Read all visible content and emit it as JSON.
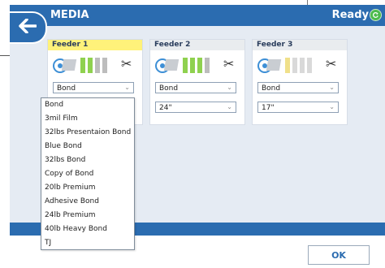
{
  "header": {
    "title": "MEDIA",
    "status": "Ready",
    "accent_color": "#2b6cb0"
  },
  "feeders": [
    {
      "name": "Feeder 1",
      "active": true,
      "media_type": "Bond",
      "width": "",
      "bar_colors": [
        "#8fd14f",
        "#8fd14f",
        "#bdbdbd",
        "#bdbdbd"
      ]
    },
    {
      "name": "Feeder 2",
      "active": false,
      "media_type": "Bond",
      "width": "24\"",
      "bar_colors": [
        "#8fd14f",
        "#8fd14f",
        "#8fd14f",
        "#bdbdbd"
      ]
    },
    {
      "name": "Feeder 3",
      "active": false,
      "media_type": "Bond",
      "width": "17\"",
      "bar_colors": [
        "#f0e08a",
        "#d9d9d9",
        "#d9d9d9",
        "#d9d9d9"
      ]
    }
  ],
  "dropdown": {
    "options": [
      "Bond",
      "3mil Film",
      "32lbs Presentaion Bond",
      "Blue Bond",
      "32lbs Bond",
      "Copy of Bond",
      "20lb Premium",
      "Adhesive Bond",
      "24lb Premium",
      "40lb Heavy Bond",
      "TJ"
    ]
  },
  "footer": {
    "ok_label": "OK"
  }
}
